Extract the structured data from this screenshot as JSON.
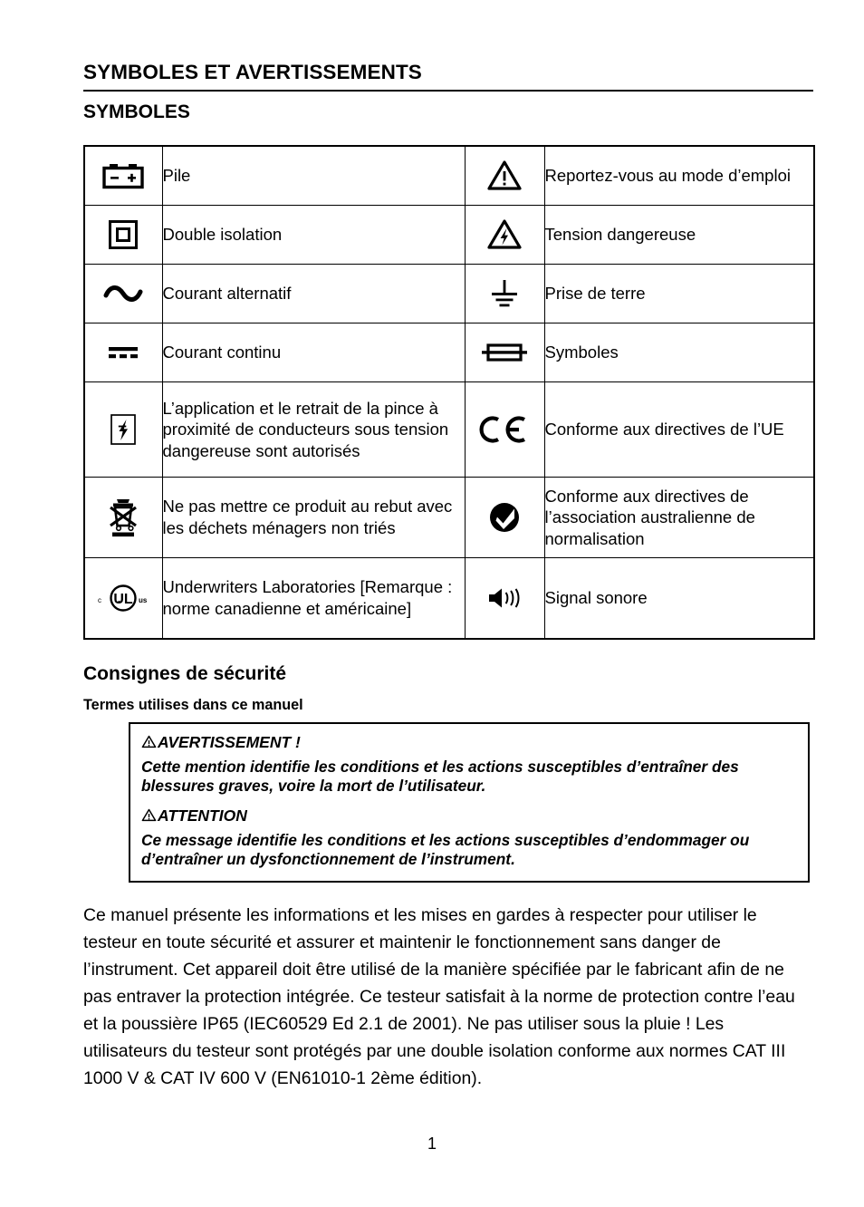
{
  "document": {
    "title": "SYMBOLES ET AVERTISSEMENTS",
    "section_title": "SYMBOLES",
    "page_number": "1"
  },
  "symbols_table": {
    "rows": [
      {
        "left": {
          "icon": "battery-icon",
          "label": "Pile"
        },
        "right": {
          "icon": "warning-triangle-icon",
          "label": "Reportez-vous au mode d’emploi"
        }
      },
      {
        "left": {
          "icon": "double-insulation-icon",
          "label": "Double isolation"
        },
        "right": {
          "icon": "high-voltage-triangle-icon",
          "label": "Tension dangereuse"
        }
      },
      {
        "left": {
          "icon": "ac-current-icon",
          "label": "Courant alternatif"
        },
        "right": {
          "icon": "earth-ground-icon",
          "label": "Prise de terre"
        }
      },
      {
        "left": {
          "icon": "dc-current-icon",
          "label": "Courant continu"
        },
        "right": {
          "icon": "fuse-icon",
          "label": "Symboles"
        }
      },
      {
        "left": {
          "icon": "lightning-box-icon",
          "label": "L’application et le retrait de la pince à proximité de conducteurs sous tension dangereuse sont autorisés"
        },
        "right": {
          "icon": "ce-mark-icon",
          "label": "Conforme aux directives de l’UE"
        }
      },
      {
        "left": {
          "icon": "weee-bin-icon",
          "label": "Ne pas mettre ce produit au rebut avec les déchets ménagers non triés"
        },
        "right": {
          "icon": "c-tick-icon",
          "label": "Conforme aux directives de l’association australienne de normalisation"
        }
      },
      {
        "left": {
          "icon": "ul-listed-icon",
          "label": "Underwriters Laboratories [Remarque : norme canadienne et américaine]"
        },
        "right": {
          "icon": "speaker-icon",
          "label": "Signal sonore"
        }
      }
    ]
  },
  "safety": {
    "heading": "Consignes de sécurité",
    "subheading": "Termes utilises dans ce manuel",
    "warning_box": {
      "warning_title": "AVERTISSEMENT !",
      "warning_text": "Cette mention identifie les conditions et les actions susceptibles d’entraîner des blessures graves, voire la mort de l’utilisateur.",
      "caution_title": "ATTENTION",
      "caution_text": "Ce message identifie les conditions et les actions susceptibles d’endommager ou d’entraîner un dysfonctionnement de l’instrument."
    },
    "paragraph": "Ce manuel présente les informations et les mises en gardes à respecter pour utiliser le testeur en toute sécurité et assurer et maintenir le fonctionnement sans danger de l’instrument. Cet appareil doit être utilisé de la manière spécifiée par le fabricant afin de ne pas entraver la protection intégrée. Ce testeur satisfait à la norme de protection contre l’eau et la poussière IP65 (IEC60529 Ed 2.1 de 2001). Ne pas utiliser sous la pluie ! Les utilisateurs du testeur sont protégés par une double isolation conforme aux normes CAT III 1000 V & CAT IV 600 V (EN61010-1 2ème édition)."
  },
  "colors": {
    "ink": "#000000",
    "paper": "#ffffff"
  }
}
